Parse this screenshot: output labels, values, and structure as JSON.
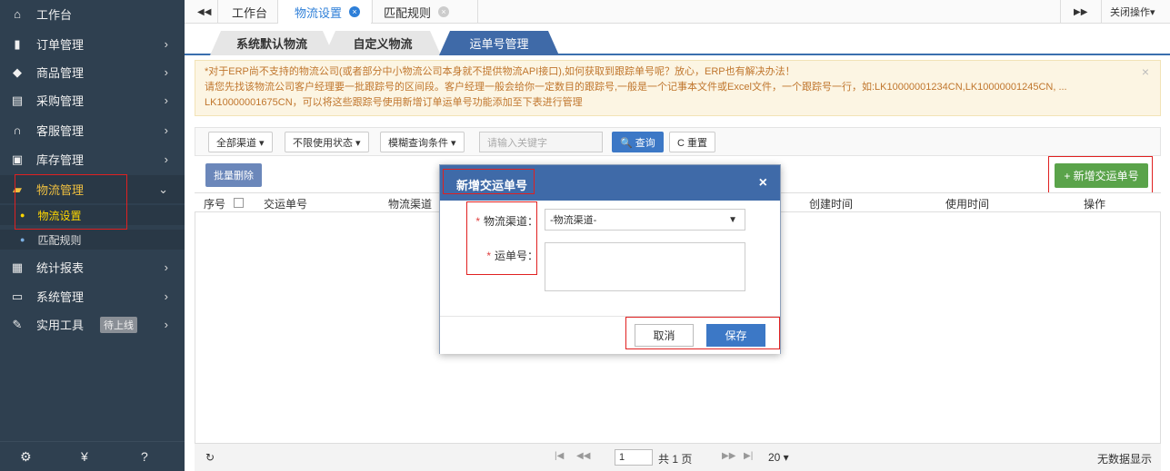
{
  "sidebar": {
    "items": [
      {
        "icon": "home-icon",
        "glyph": "⌂",
        "label": "工作台"
      },
      {
        "icon": "clipboard-icon",
        "glyph": "▮",
        "label": "订单管理",
        "arrow": "›"
      },
      {
        "icon": "cube-icon",
        "glyph": "◆",
        "label": "商品管理",
        "arrow": "›"
      },
      {
        "icon": "cart-icon",
        "glyph": "▤",
        "label": "采购管理",
        "arrow": "›"
      },
      {
        "icon": "headset-icon",
        "glyph": "∩",
        "label": "客服管理",
        "arrow": "›"
      },
      {
        "icon": "inbox-icon",
        "glyph": "▣",
        "label": "库存管理",
        "arrow": "›"
      },
      {
        "icon": "truck-icon",
        "glyph": "▰",
        "label": "物流管理",
        "arrow": "⌄"
      },
      {
        "icon": "report-icon",
        "glyph": "▦",
        "label": "统计报表",
        "arrow": "›"
      },
      {
        "icon": "monitor-icon",
        "glyph": "▭",
        "label": "系统管理",
        "arrow": "›"
      },
      {
        "icon": "wrench-icon",
        "glyph": "✎",
        "label": "实用工具",
        "badge": "待上线",
        "arrow": "›"
      }
    ],
    "subitems": [
      {
        "label": "物流设置",
        "active": true
      },
      {
        "label": "匹配规则",
        "active": false
      }
    ],
    "bottom_icons": [
      {
        "name": "settings-icon",
        "glyph": "⚙"
      },
      {
        "name": "yen-icon",
        "glyph": "¥"
      },
      {
        "name": "help-icon",
        "glyph": "?"
      }
    ]
  },
  "tabbar": {
    "back_glyph": "◀◀",
    "tabs": [
      {
        "label": "工作台"
      },
      {
        "label": "物流设置",
        "close": "×"
      },
      {
        "label": "匹配规则",
        "close": "×"
      }
    ],
    "forward_glyph": "▶▶",
    "close_ops": "关闭操作▾"
  },
  "subtabs": [
    "系统默认物流",
    "自定义物流",
    "运单号管理"
  ],
  "notice": {
    "line1": "*对于ERP尚不支持的物流公司(或者部分中小物流公司本身就不提供物流API接口),如何获取到跟踪单号呢？放心，ERP也有解决办法！",
    "line2": "请您先找该物流公司客户经理要一批跟踪号的区间段。客户经理一般会给你一定数目的跟踪号,一般是一个记事本文件或Excel文件，一个跟踪号一行，如:LK10000001234CN,LK10000001245CN, ...",
    "line3": "LK10000001675CN，可以将这些跟踪号使用新增订单运单号功能添加至下表进行管理",
    "close": "×"
  },
  "filters": {
    "all_channels": "全部渠道 ▾",
    "status": "不限使用状态 ▾",
    "fuzzy": "模糊查询条件 ▾",
    "keyword_placeholder": "请输入关键字",
    "query": "🔍 查询",
    "reset": "C 重置"
  },
  "actions": {
    "batch_delete": "批量删除",
    "add_tracking": "+ 新增交运单号"
  },
  "table": {
    "headers": [
      "序号",
      "交运单号",
      "物流渠道",
      "创建时间",
      "使用时间",
      "操作"
    ]
  },
  "footer": {
    "refresh": "↻",
    "first": "|◀",
    "prev": "◀◀",
    "page": "1",
    "total": "共 1 页",
    "next": "▶▶",
    "last": "▶|",
    "page_size": "20 ▾",
    "no_data": "无数据显示"
  },
  "modal": {
    "title": "新增交运单号",
    "close": "×",
    "channel_label": "物流渠道：",
    "channel_value": "-物流渠道-",
    "tracking_label": "运单号：",
    "required_mark": "*",
    "cancel": "取消",
    "save": "保存"
  },
  "colors": {
    "sidebar_bg": "#2f4050",
    "accent_blue": "#3f6aa8",
    "add_green": "#5aa34a",
    "highlight_red": "#e02020"
  }
}
